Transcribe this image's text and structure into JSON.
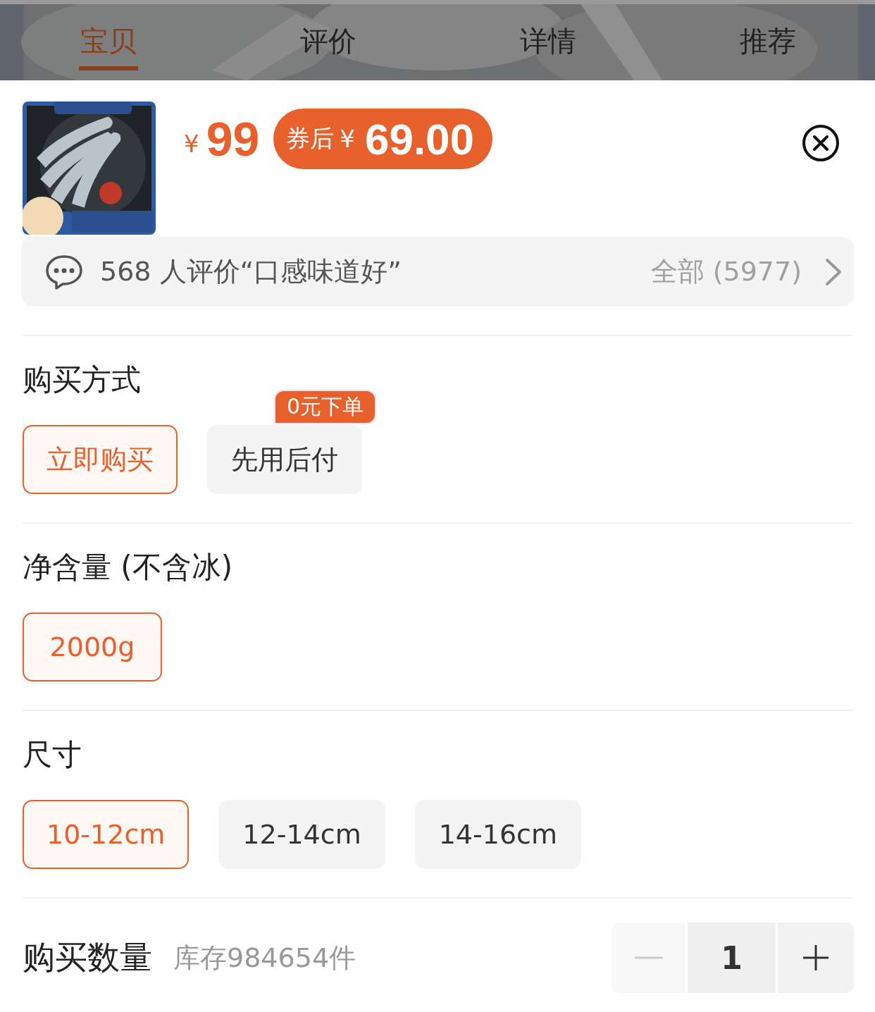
{
  "tabs": [
    {
      "label": "宝贝",
      "selected": true
    },
    {
      "label": "评价",
      "selected": false
    },
    {
      "label": "详情",
      "selected": false
    },
    {
      "label": "推荐",
      "selected": false
    }
  ],
  "product": {
    "price_symbol": "¥",
    "price": "99",
    "coupon": {
      "label": "券后",
      "symbol": "¥",
      "price": "69.00"
    }
  },
  "review_bar": {
    "text": "568 人评价“口感味道好”",
    "all": "全部 (5977)"
  },
  "sections": [
    {
      "title": "购买方式",
      "options": [
        {
          "label": "立即购买",
          "selected": true
        },
        {
          "label": "先用后付",
          "selected": false,
          "badge": "0元下单"
        }
      ]
    },
    {
      "title": "净含量 (不含冰)",
      "options": [
        {
          "label": "2000g",
          "selected": true
        }
      ]
    },
    {
      "title": "尺寸",
      "options": [
        {
          "label": "10-12cm",
          "selected": true
        },
        {
          "label": "12-14cm",
          "selected": false
        },
        {
          "label": "14-16cm",
          "selected": false
        }
      ]
    }
  ],
  "quantity": {
    "label": "购买数量",
    "stock": "库存984654件",
    "value": "1",
    "decrease_disabled": true
  }
}
